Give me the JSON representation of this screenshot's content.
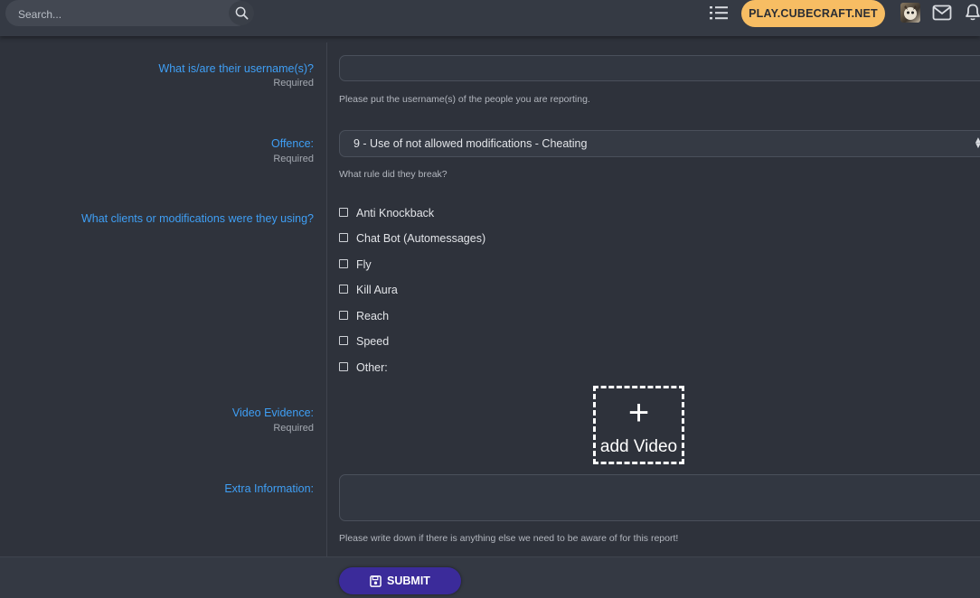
{
  "header": {
    "search_placeholder": "Search...",
    "play_button": "PLAY.CUBECRAFT.NET"
  },
  "form": {
    "usernames": {
      "label": "What is/are their username(s)?",
      "required": "Required",
      "value": "",
      "hint": "Please put the username(s) of the people you are reporting."
    },
    "offence": {
      "label": "Offence:",
      "required": "Required",
      "selected": "9 - Use of not allowed modifications - Cheating",
      "hint": "What rule did they break?"
    },
    "clients": {
      "label": "What clients or modifications were they using?",
      "options": [
        {
          "label": "Anti Knockback",
          "checked": false
        },
        {
          "label": "Chat Bot (Automessages)",
          "checked": false
        },
        {
          "label": "Fly",
          "checked": false
        },
        {
          "label": "Kill Aura",
          "checked": false
        },
        {
          "label": "Reach",
          "checked": false
        },
        {
          "label": "Speed",
          "checked": false
        },
        {
          "label": "Other:",
          "checked": false
        }
      ]
    },
    "video": {
      "label": "Video Evidence:",
      "required": "Required",
      "add_label": "add Video"
    },
    "extra": {
      "label": "Extra Information:",
      "value": "",
      "hint": "Please write down if there is anything else we need to be aware of for this report!"
    },
    "submit_label": "SUBMIT"
  },
  "colors": {
    "accent_label": "#3f9ff5",
    "play_button": "#f7bd63",
    "submit_button": "#3b2b9a",
    "background": "#2e323b"
  },
  "icons": [
    "search-icon",
    "list-icon",
    "avatar",
    "mail-icon",
    "bell-icon",
    "plus-icon",
    "save-icon"
  ]
}
